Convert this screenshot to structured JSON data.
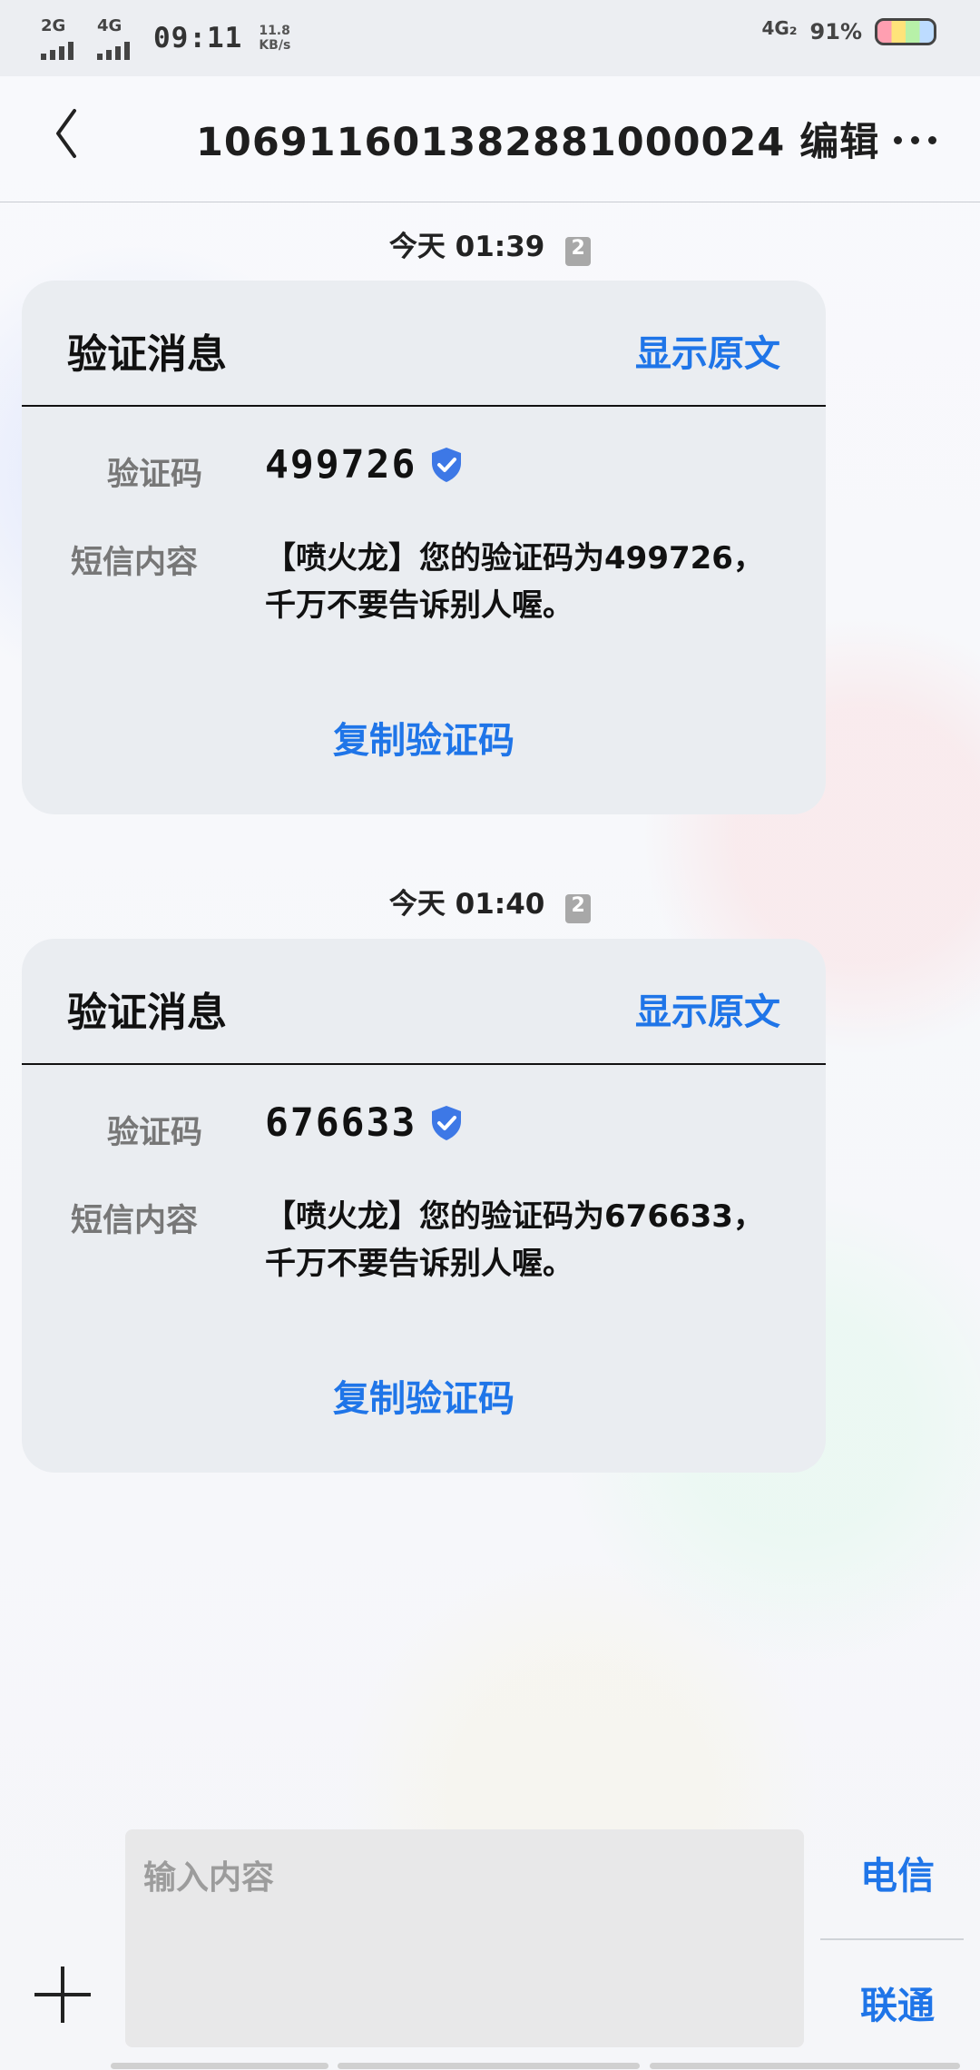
{
  "status_bar": {
    "network_left": [
      "2G",
      "4G"
    ],
    "time": "09:11",
    "speed_value": "11.8",
    "speed_unit": "KB/s",
    "network_right": "4G₂",
    "battery_percent": "91%"
  },
  "app_bar": {
    "title": "106911601382881000024 编辑"
  },
  "messages": [
    {
      "timestamp": "今天 01:39",
      "badge": "2",
      "card_title": "验证消息",
      "show_original": "显示原文",
      "code_label": "验证码",
      "code": "499726",
      "body_label": "短信内容",
      "body": "【喷火龙】您的验证码为499726，千万不要告诉别人喔。",
      "copy_button": "复制验证码"
    },
    {
      "timestamp": "今天 01:40",
      "badge": "2",
      "card_title": "验证消息",
      "show_original": "显示原文",
      "code_label": "验证码",
      "code": "676633",
      "body_label": "短信内容",
      "body": "【喷火龙】您的验证码为676633，千万不要告诉别人喔。",
      "copy_button": "复制验证码"
    }
  ],
  "composer": {
    "placeholder": "输入内容",
    "carriers": [
      "电信",
      "联通"
    ]
  },
  "colors": {
    "accent_blue": "#1f75e8",
    "card_bg": "#eaedf1",
    "text_dark": "#111111",
    "label_gray": "#777777",
    "input_gray": "#e8e8e9"
  },
  "icons": {
    "back": "chevron-left-icon",
    "more": "more-horizontal-icon",
    "verified": "shield-check-icon",
    "add": "plus-icon"
  }
}
